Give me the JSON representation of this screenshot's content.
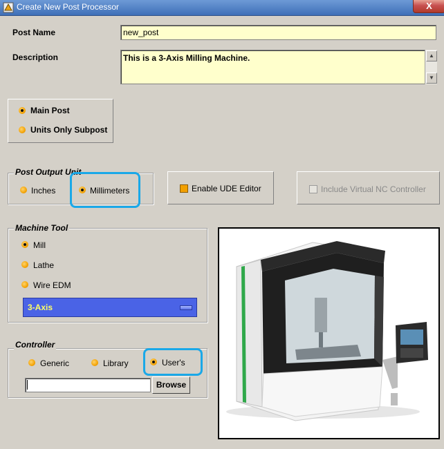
{
  "window": {
    "title": "Create New Post Processor",
    "close_label": "X"
  },
  "post_name": {
    "label": "Post Name",
    "value": "new_post"
  },
  "description": {
    "label": "Description",
    "value": "This is a 3-Axis Milling Machine."
  },
  "post_type": {
    "options": [
      "Main Post",
      "Units Only Subpost"
    ],
    "selected": "Main Post"
  },
  "output_unit": {
    "title": "Post Output Unit",
    "options": [
      "Inches",
      "Millimeters"
    ],
    "selected": "Millimeters"
  },
  "ude_editor": {
    "label": "Enable UDE Editor"
  },
  "virtual_nc": {
    "label": "Include Virtual NC Controller"
  },
  "machine_tool": {
    "title": "Machine Tool",
    "options": [
      "Mill",
      "Lathe",
      "Wire EDM"
    ],
    "selected": "Mill",
    "axis_selected": "3-Axis"
  },
  "controller": {
    "title": "Controller",
    "options": [
      "Generic",
      "Library",
      "User's"
    ],
    "selected": "User's",
    "path_value": "",
    "browse_label": "Browse"
  },
  "colors": {
    "dialog_bg": "#d4d0c8",
    "field_bg": "#ffffcc",
    "radio": "#f2a000",
    "dropdown": "#4a63e6",
    "highlight": "#1aa8e8"
  }
}
